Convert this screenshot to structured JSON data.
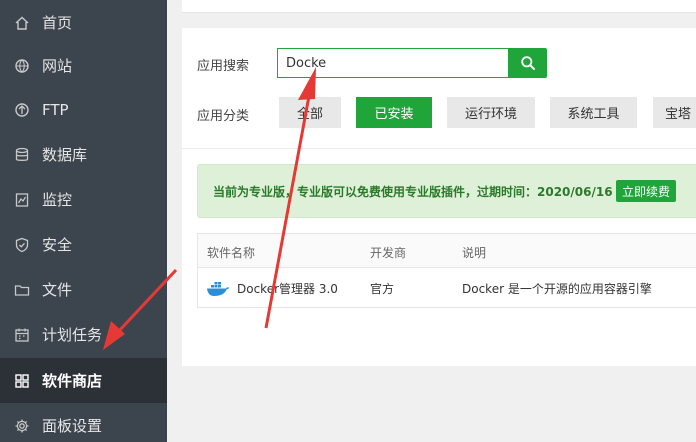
{
  "sidebar": {
    "items": [
      {
        "label": "首页",
        "icon": "home-icon",
        "active": false
      },
      {
        "label": "网站",
        "icon": "globe-icon",
        "active": false
      },
      {
        "label": "FTP",
        "icon": "ftp-icon",
        "active": false
      },
      {
        "label": "数据库",
        "icon": "database-icon",
        "active": false
      },
      {
        "label": "监控",
        "icon": "monitor-icon",
        "active": false
      },
      {
        "label": "安全",
        "icon": "shield-icon",
        "active": false
      },
      {
        "label": "文件",
        "icon": "folder-icon",
        "active": false
      },
      {
        "label": "计划任务",
        "icon": "calendar-icon",
        "active": false
      },
      {
        "label": "软件商店",
        "icon": "grid-icon",
        "active": true
      },
      {
        "label": "面板设置",
        "icon": "gear-icon",
        "active": false
      }
    ]
  },
  "search": {
    "label": "应用搜索",
    "value": "Docke"
  },
  "category": {
    "label": "应用分类",
    "items": [
      "全部",
      "已安装",
      "运行环境",
      "系统工具",
      "宝塔"
    ]
  },
  "notice": {
    "text": "当前为专业版，专业版可以免费使用专业版插件，过期时间：2020/06/16",
    "renew_label": "立即续费"
  },
  "table": {
    "headers": [
      "软件名称",
      "开发商",
      "说明"
    ],
    "rows": [
      {
        "name": "Docker管理器 3.0",
        "developer": "官方",
        "description": "Docker 是一个开源的应用容器引擎",
        "icon": "docker-icon"
      }
    ]
  },
  "colors": {
    "accent": "#20a53a",
    "sidebar_bg": "#3c444d",
    "annotation_arrow": "#e53935"
  }
}
